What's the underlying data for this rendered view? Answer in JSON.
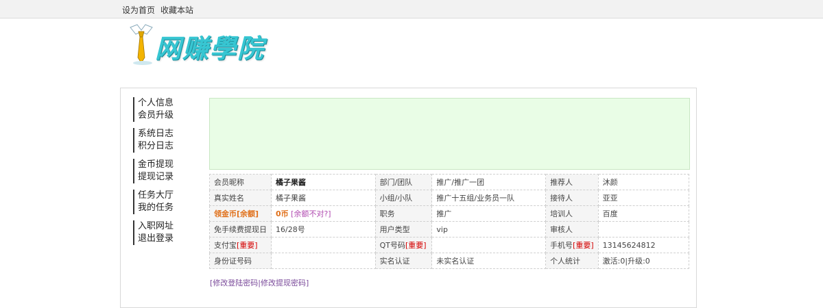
{
  "topbar": {
    "set_home": "设为首页",
    "bookmark": "收藏本站"
  },
  "logo": {
    "text": "网赚學院"
  },
  "sidebar": {
    "groups": [
      [
        "个人信息",
        "会员升级"
      ],
      [
        "系统日志",
        "积分日志"
      ],
      [
        "金币提现",
        "提现记录"
      ],
      [
        "任务大厅",
        "我的任务"
      ],
      [
        "入职网址",
        "退出登录"
      ]
    ]
  },
  "info": {
    "nickname_label": "会员昵称",
    "nickname": "橘子果酱",
    "dept_label": "部门/团队",
    "dept": "推广/推广一团",
    "referrer_label": "推荐人",
    "referrer": "沐颜",
    "realname_label": "真实姓名",
    "realname": "橘子果酱",
    "group_label": "小组/小队",
    "group": "推广十五组/业务员一队",
    "receiver_label": "接待人",
    "receiver": "亚亚",
    "coin_label_a": "领金币",
    "coin_label_b": "[余额]",
    "coin_value": "0币",
    "coin_note": "[余额不对?]",
    "position_label": "职务",
    "position": "推广",
    "trainer_label": "培训人",
    "trainer": "百度",
    "fee_label": "免手续费提现日",
    "fee_day": "16/28号",
    "usertype_label": "用户类型",
    "usertype": "vip",
    "auditor_label": "审核人",
    "auditor": "",
    "alipay_label": "支付宝",
    "important": "[重要]",
    "alipay": "",
    "qt_label": "QT号码",
    "qt": "",
    "phone_label": "手机号",
    "phone": "13145624812",
    "idcard_label": "身份证号码",
    "idcard": "",
    "realauth_label": "实名认证",
    "realauth": "未实名认证",
    "stats_label": "个人统计",
    "stats": "激活:0|升级:0"
  },
  "bottom": {
    "open": "[",
    "change_login": "修改登陆密码",
    "sep": "|",
    "change_withdraw": "修改提现密码",
    "close": "]"
  }
}
